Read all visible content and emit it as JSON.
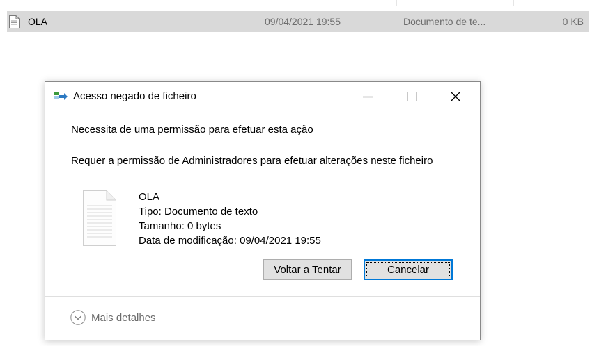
{
  "file_list": {
    "row": {
      "name": "OLA",
      "date": "09/04/2021 19:55",
      "type": "Documento de te...",
      "size": "0 KB",
      "icon": "text-file-icon"
    }
  },
  "dialog": {
    "title": "Acesso negado de ficheiro",
    "title_icon": "file-transfer-icon",
    "heading": "Necessita de uma permissão para efetuar esta ação",
    "message": "Requer a permissão de Administradores para efetuar alterações neste ficheiro",
    "file": {
      "icon": "document-icon",
      "name": "OLA",
      "type": "Tipo: Documento de texto",
      "size": "Tamanho: 0 bytes",
      "modified": "Data de modificação: 09/04/2021 19:55"
    },
    "buttons": {
      "retry": "Voltar a Tentar",
      "cancel": "Cancelar"
    },
    "more_details": "Mais detalhes"
  },
  "colors": {
    "selected_row": "#d9d9d9",
    "focus_blue": "#0078d7",
    "muted_text": "#6d6d6d"
  }
}
